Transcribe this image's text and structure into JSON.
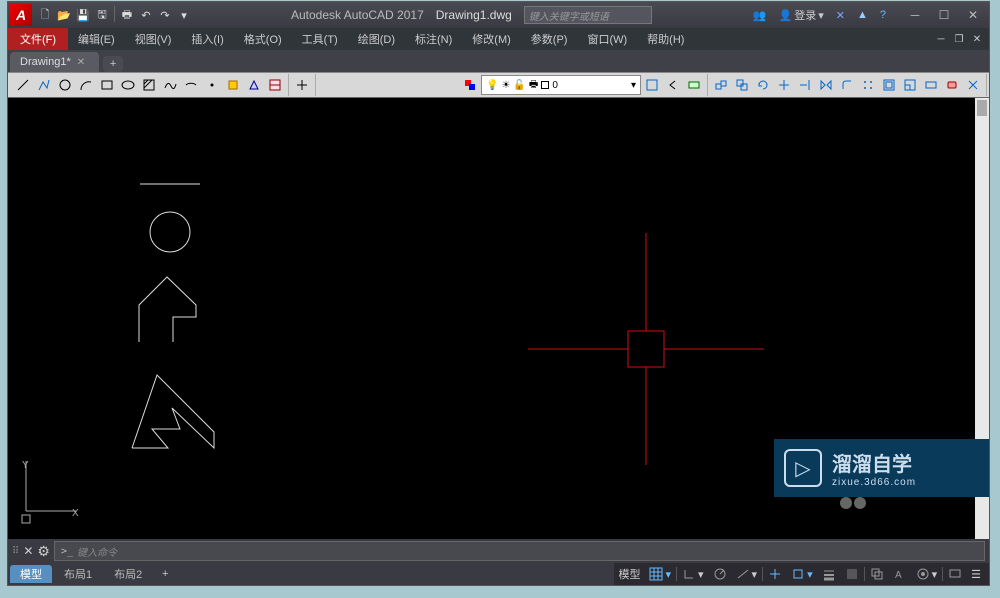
{
  "title": {
    "app": "Autodesk AutoCAD 2017",
    "file": "Drawing1.dwg"
  },
  "search": {
    "placeholder": "键入关键字或短语"
  },
  "login": {
    "label": "登录"
  },
  "app_letter": "A",
  "menu": [
    {
      "id": "file",
      "label": "文件(F)"
    },
    {
      "id": "edit",
      "label": "编辑(E)"
    },
    {
      "id": "view",
      "label": "视图(V)"
    },
    {
      "id": "insert",
      "label": "插入(I)"
    },
    {
      "id": "format",
      "label": "格式(O)"
    },
    {
      "id": "tools",
      "label": "工具(T)"
    },
    {
      "id": "draw",
      "label": "绘图(D)"
    },
    {
      "id": "dimension",
      "label": "标注(N)"
    },
    {
      "id": "modify",
      "label": "修改(M)"
    },
    {
      "id": "params",
      "label": "参数(P)"
    },
    {
      "id": "window",
      "label": "窗口(W)"
    },
    {
      "id": "help",
      "label": "帮助(H)"
    }
  ],
  "filetabs": [
    {
      "label": "Drawing1*"
    }
  ],
  "layer": {
    "current": "0"
  },
  "layer_icons": [
    "bulb",
    "sun",
    "lock",
    "print",
    "color"
  ],
  "command": {
    "placeholder": "键入命令"
  },
  "bottom_tabs": [
    {
      "id": "model",
      "label": "模型",
      "active": true
    },
    {
      "id": "layout1",
      "label": "布局1",
      "active": false
    },
    {
      "id": "layout2",
      "label": "布局2",
      "active": false
    }
  ],
  "status": {
    "model_label": "模型"
  },
  "watermark": {
    "main": "溜溜自学",
    "sub": "zixue.3d66.com"
  },
  "ucs": {
    "x": "X",
    "y": "Y"
  },
  "colors": {
    "crosshair": "#d01010",
    "drawing": "#dddddd",
    "canvas": "#000000"
  }
}
